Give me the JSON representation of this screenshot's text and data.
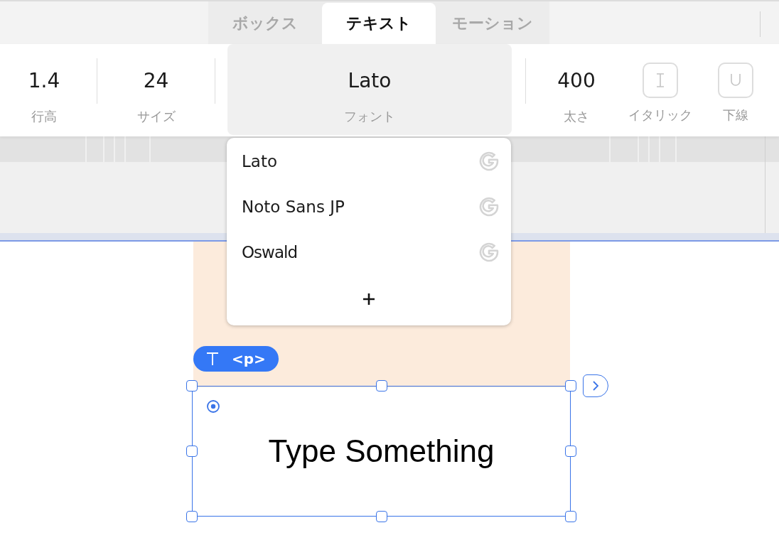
{
  "tabs": [
    {
      "label": "ボックス",
      "selected": false
    },
    {
      "label": "テキスト",
      "selected": true
    },
    {
      "label": "モーション",
      "selected": false
    }
  ],
  "toolbar": [
    {
      "kind": "number",
      "value": "1.4",
      "label": "行高"
    },
    {
      "kind": "number",
      "value": "24",
      "label": "サイズ"
    },
    {
      "kind": "font",
      "value": "Lato",
      "label": "フォント"
    },
    {
      "kind": "number",
      "value": "400",
      "label": "太さ"
    },
    {
      "kind": "italic",
      "on": false,
      "label": "イタリック"
    },
    {
      "kind": "underline",
      "on": false,
      "label": "下線"
    }
  ],
  "font_menu": {
    "items": [
      {
        "name": "Lato",
        "kind": "google"
      },
      {
        "name": "Noto Sans JP",
        "kind": "google"
      },
      {
        "name": "Oswald",
        "kind": "google"
      }
    ]
  },
  "canvas": {
    "element_tag": "<p>",
    "text": "Type Something"
  }
}
